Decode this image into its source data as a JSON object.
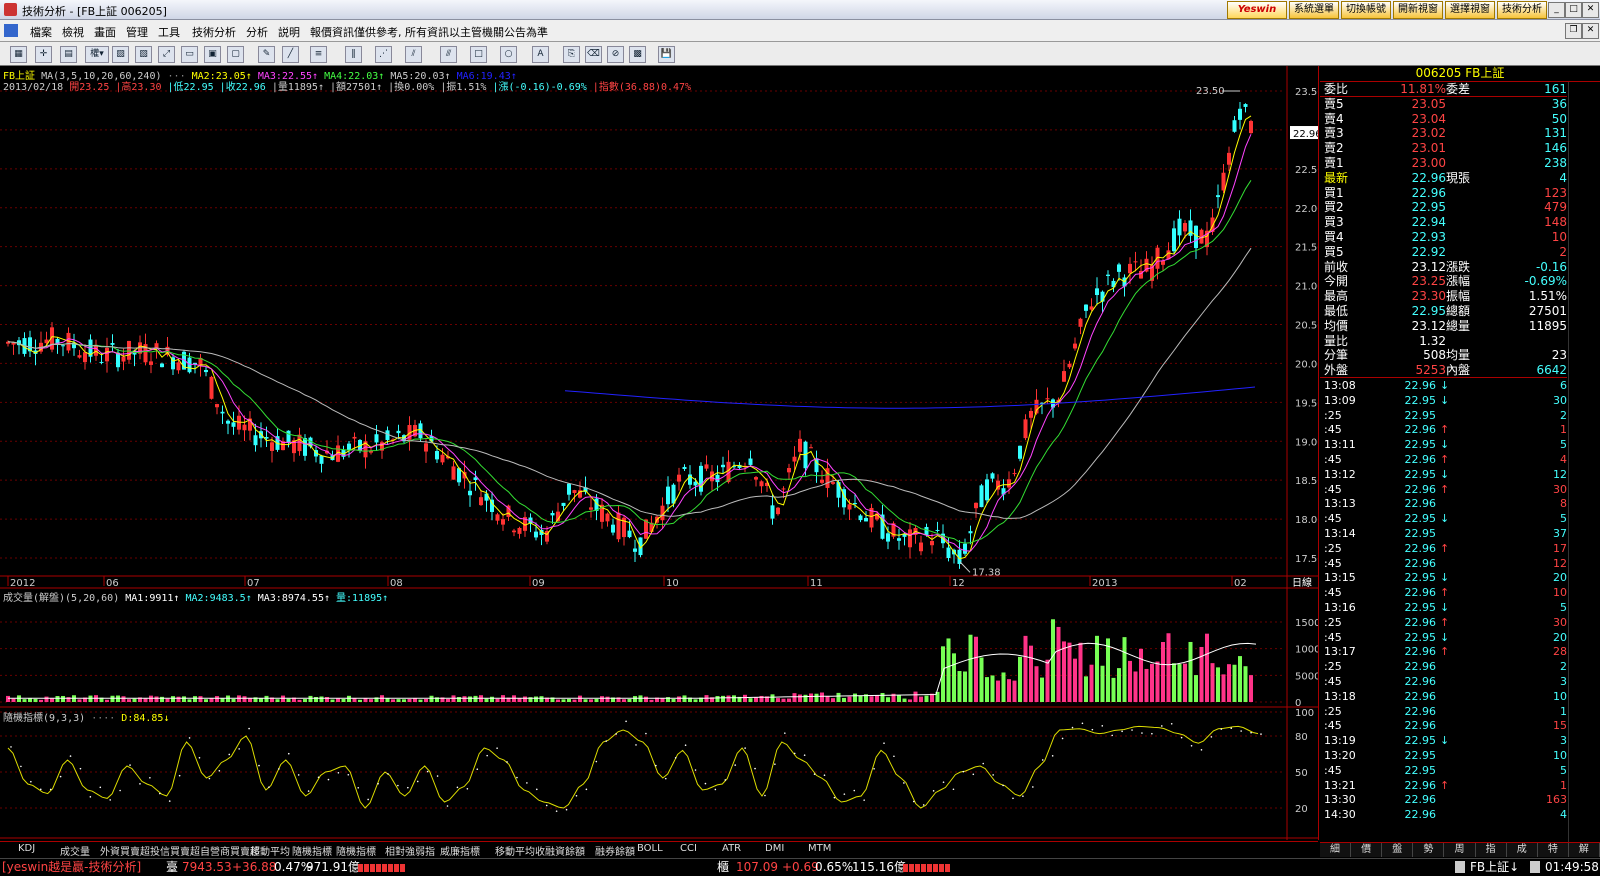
{
  "window": {
    "title": "技術分析 - [FB上証 006205]"
  },
  "topbar": {
    "logo": "Yeswin",
    "buttons": [
      "系統選單",
      "切換帳號",
      "開新視窗",
      "選擇視窗",
      "技術分析"
    ]
  },
  "menu": [
    "檔案",
    "檢視",
    "畫面",
    "管理",
    "工具",
    "技術分析",
    "分析",
    "説明",
    "報價資訊僅供參考, 所有資訊以主管機關公告為準"
  ],
  "chart": {
    "symbol": "FB上証",
    "ma_header": "MA(3,5,10,20,60,240)",
    "ma_values": [
      {
        "label": "MA2:23.05↑",
        "color": "#ffff00"
      },
      {
        "label": "MA3:22.55↑",
        "color": "#ff44ff"
      },
      {
        "label": "MA4:22.03↑",
        "color": "#44ff44"
      },
      {
        "label": "MA5:20.03↑",
        "color": "#cccccc"
      },
      {
        "label": "MA6:19.43↑",
        "color": "#2222ff"
      }
    ],
    "bar_info": [
      {
        "t": "2013/02/18 ",
        "c": "#cccccc"
      },
      {
        "t": "開23.25",
        "c": "#ff4444"
      },
      {
        "t": "|高23.30",
        "c": "#ff4444"
      },
      {
        "t": "|低22.95",
        "c": "#44ffff"
      },
      {
        "t": "|收22.96",
        "c": "#44ffff"
      },
      {
        "t": "|量11895↑",
        "c": "#cccccc"
      },
      {
        "t": "|額27501↑",
        "c": "#cccccc"
      },
      {
        "t": "|換0.00%",
        "c": "#cccccc"
      },
      {
        "t": "|振1.51%",
        "c": "#cccccc"
      },
      {
        "t": "|漲(-0.16)-0.69%",
        "c": "#44ffff"
      },
      {
        "t": "|指數(36.88)0.47%",
        "c": "#ff4444"
      }
    ],
    "price_axis": [
      "23.50",
      "23.00",
      "22.50",
      "22.00",
      "21.50",
      "21.00",
      "20.50",
      "20.00",
      "19.50",
      "19.00",
      "18.50",
      "18.00",
      "17.50"
    ],
    "current_price_tag": "22.96",
    "high_label": "23.50",
    "low_label": "17.38",
    "date_axis": [
      "2012",
      "06",
      "07",
      "08",
      "09",
      "10",
      "11",
      "12",
      "2013",
      "02"
    ],
    "date_axis_right": "日線",
    "volume_header": "成交量(解盤)(5,20,60)",
    "volume_values": [
      {
        "label": "MA1:9911↑",
        "color": "#ffffff"
      },
      {
        "label": "MA2:9483.5↑",
        "color": "#44ffff"
      },
      {
        "label": "MA3:8974.55↑",
        "color": "#ffffff"
      },
      {
        "label": "量:11895↑",
        "color": "#44ffff"
      }
    ],
    "volume_axis": [
      "15000",
      "10000",
      "5000",
      "0"
    ],
    "kd_header": "隨機指標(9,3,3)",
    "kd_value": "D:84.85↓",
    "kd_axis": [
      "100",
      "80",
      "50",
      "20"
    ],
    "chart_data": {
      "type": "candlestick",
      "kd_d": [
        70,
        40,
        32,
        60,
        35,
        28,
        55,
        40,
        30,
        75,
        45,
        60,
        80,
        35,
        60,
        30,
        50,
        55,
        20,
        50,
        30,
        55,
        25,
        38,
        70,
        60,
        35,
        25,
        20,
        40,
        75,
        85,
        75,
        45,
        68,
        35,
        40,
        70,
        30,
        75,
        60,
        45,
        25,
        30,
        68,
        45,
        20,
        35,
        50,
        55,
        40,
        30,
        55,
        85,
        86,
        82,
        85,
        88,
        87,
        82,
        74,
        86,
        88,
        82
      ]
    }
  },
  "tabs": [
    "KDJ",
    "成交量",
    "外資買賣超",
    "投信買賣超",
    "自營商買賣超",
    "移動平均",
    "隨機指標",
    "隨機指標",
    "相對強弱指",
    "威廉指標",
    "移動平均收",
    "融資餘額",
    "融券餘額",
    "BOLL",
    "CCI",
    "ATR",
    "DMI",
    "MTM"
  ],
  "quote": {
    "header": "006205 FB上証",
    "rows": [
      {
        "l": "委比",
        "v": "11.81%",
        "vc": "#ff4444",
        "l2": "委差",
        "v2": "161",
        "v2c": "#44ffff"
      },
      {
        "l": "賣5",
        "v": "23.05",
        "vc": "#ff4444",
        "l2": "",
        "v2": "36",
        "v2c": "#44ffff"
      },
      {
        "l": "賣4",
        "v": "23.04",
        "vc": "#ff4444",
        "l2": "",
        "v2": "50",
        "v2c": "#44ffff"
      },
      {
        "l": "賣3",
        "v": "23.02",
        "vc": "#ff4444",
        "l2": "",
        "v2": "131",
        "v2c": "#44ffff"
      },
      {
        "l": "賣2",
        "v": "23.01",
        "vc": "#ff4444",
        "l2": "",
        "v2": "146",
        "v2c": "#44ffff"
      },
      {
        "l": "賣1",
        "v": "23.00",
        "vc": "#ff4444",
        "l2": "",
        "v2": "238",
        "v2c": "#44ffff"
      },
      {
        "l": "最新",
        "v": "22.96",
        "vc": "#44ffff",
        "l2": "現張",
        "v2": "4",
        "v2c": "#44ffff"
      },
      {
        "l": "買1",
        "v": "22.96",
        "vc": "#44ffff",
        "l2": "",
        "v2": "123",
        "v2c": "#ff4444"
      },
      {
        "l": "買2",
        "v": "22.95",
        "vc": "#44ffff",
        "l2": "",
        "v2": "479",
        "v2c": "#ff4444"
      },
      {
        "l": "買3",
        "v": "22.94",
        "vc": "#44ffff",
        "l2": "",
        "v2": "148",
        "v2c": "#ff4444"
      },
      {
        "l": "買4",
        "v": "22.93",
        "vc": "#44ffff",
        "l2": "",
        "v2": "10",
        "v2c": "#ff4444"
      },
      {
        "l": "買5",
        "v": "22.92",
        "vc": "#44ffff",
        "l2": "",
        "v2": "2",
        "v2c": "#ff4444"
      },
      {
        "l": "前收",
        "v": "23.12",
        "vc": "#ffffff",
        "l2": "漲跌",
        "v2": "-0.16",
        "v2c": "#44ffff"
      },
      {
        "l": "今開",
        "v": "23.25",
        "vc": "#ff4444",
        "l2": "漲幅",
        "v2": "-0.69%",
        "v2c": "#44ffff"
      },
      {
        "l": "最高",
        "v": "23.30",
        "vc": "#ff4444",
        "l2": "振幅",
        "v2": "1.51%",
        "v2c": "#ffffff"
      },
      {
        "l": "最低",
        "v": "22.95",
        "vc": "#44ffff",
        "l2": "總額",
        "v2": "27501",
        "v2c": "#ffffff"
      },
      {
        "l": "均價",
        "v": "23.12",
        "vc": "#ffffff",
        "l2": "總量",
        "v2": "11895",
        "v2c": "#ffffff"
      },
      {
        "l": "量比",
        "v": "1.32",
        "vc": "#ffffff",
        "l2": "",
        "v2": "",
        "v2c": "#ffffff"
      },
      {
        "l": "分筆",
        "v": "508",
        "vc": "#ffffff",
        "l2": "均量",
        "v2": "23",
        "v2c": "#ffffff"
      },
      {
        "l": "外盤",
        "v": "5253",
        "vc": "#ff4444",
        "l2": "內盤",
        "v2": "6642",
        "v2c": "#44ffff"
      }
    ],
    "ticks": [
      {
        "t": "13:08",
        "p": "22.96",
        "pc": "#44ffff",
        "a": "↓",
        "ac": "#44ffff",
        "v": "6",
        "vc": "#44ffff"
      },
      {
        "t": "13:09",
        "p": "22.95",
        "pc": "#44ffff",
        "a": "↓",
        "ac": "#44ffff",
        "v": "30",
        "vc": "#44ffff"
      },
      {
        "t": ":25",
        "p": "22.95",
        "pc": "#44ffff",
        "a": "",
        "ac": "#44ffff",
        "v": "2",
        "vc": "#44ffff"
      },
      {
        "t": ":45",
        "p": "22.96",
        "pc": "#44ffff",
        "a": "↑",
        "ac": "#ff4444",
        "v": "1",
        "vc": "#ff4444"
      },
      {
        "t": "13:11",
        "p": "22.95",
        "pc": "#44ffff",
        "a": "↓",
        "ac": "#44ffff",
        "v": "5",
        "vc": "#44ffff"
      },
      {
        "t": ":45",
        "p": "22.96",
        "pc": "#44ffff",
        "a": "↑",
        "ac": "#ff4444",
        "v": "4",
        "vc": "#ff4444"
      },
      {
        "t": "13:12",
        "p": "22.95",
        "pc": "#44ffff",
        "a": "↓",
        "ac": "#44ffff",
        "v": "12",
        "vc": "#44ffff"
      },
      {
        "t": ":45",
        "p": "22.96",
        "pc": "#44ffff",
        "a": "↑",
        "ac": "#ff4444",
        "v": "30",
        "vc": "#ff4444"
      },
      {
        "t": "13:13",
        "p": "22.96",
        "pc": "#44ffff",
        "a": "",
        "ac": "#44ffff",
        "v": "8",
        "vc": "#ff4444"
      },
      {
        "t": ":45",
        "p": "22.95",
        "pc": "#44ffff",
        "a": "↓",
        "ac": "#44ffff",
        "v": "5",
        "vc": "#44ffff"
      },
      {
        "t": "13:14",
        "p": "22.95",
        "pc": "#44ffff",
        "a": "",
        "ac": "#44ffff",
        "v": "37",
        "vc": "#44ffff"
      },
      {
        "t": ":25",
        "p": "22.96",
        "pc": "#44ffff",
        "a": "↑",
        "ac": "#ff4444",
        "v": "17",
        "vc": "#ff4444"
      },
      {
        "t": ":45",
        "p": "22.96",
        "pc": "#44ffff",
        "a": "",
        "ac": "#44ffff",
        "v": "12",
        "vc": "#ff4444"
      },
      {
        "t": "13:15",
        "p": "22.95",
        "pc": "#44ffff",
        "a": "↓",
        "ac": "#44ffff",
        "v": "20",
        "vc": "#44ffff"
      },
      {
        "t": ":45",
        "p": "22.96",
        "pc": "#44ffff",
        "a": "↑",
        "ac": "#ff4444",
        "v": "10",
        "vc": "#ff4444"
      },
      {
        "t": "13:16",
        "p": "22.95",
        "pc": "#44ffff",
        "a": "↓",
        "ac": "#44ffff",
        "v": "5",
        "vc": "#44ffff"
      },
      {
        "t": ":25",
        "p": "22.96",
        "pc": "#44ffff",
        "a": "↑",
        "ac": "#ff4444",
        "v": "30",
        "vc": "#ff4444"
      },
      {
        "t": ":45",
        "p": "22.95",
        "pc": "#44ffff",
        "a": "↓",
        "ac": "#44ffff",
        "v": "20",
        "vc": "#44ffff"
      },
      {
        "t": "13:17",
        "p": "22.96",
        "pc": "#44ffff",
        "a": "↑",
        "ac": "#ff4444",
        "v": "28",
        "vc": "#ff4444"
      },
      {
        "t": ":25",
        "p": "22.96",
        "pc": "#44ffff",
        "a": "",
        "ac": "#44ffff",
        "v": "2",
        "vc": "#44ffff"
      },
      {
        "t": ":45",
        "p": "22.96",
        "pc": "#44ffff",
        "a": "",
        "ac": "#44ffff",
        "v": "3",
        "vc": "#44ffff"
      },
      {
        "t": "13:18",
        "p": "22.96",
        "pc": "#44ffff",
        "a": "",
        "ac": "#44ffff",
        "v": "10",
        "vc": "#44ffff"
      },
      {
        "t": ":25",
        "p": "22.96",
        "pc": "#44ffff",
        "a": "",
        "ac": "#44ffff",
        "v": "1",
        "vc": "#44ffff"
      },
      {
        "t": ":45",
        "p": "22.96",
        "pc": "#44ffff",
        "a": "",
        "ac": "#44ffff",
        "v": "15",
        "vc": "#ff4444"
      },
      {
        "t": "13:19",
        "p": "22.95",
        "pc": "#44ffff",
        "a": "↓",
        "ac": "#44ffff",
        "v": "3",
        "vc": "#44ffff"
      },
      {
        "t": "13:20",
        "p": "22.95",
        "pc": "#44ffff",
        "a": "",
        "ac": "#44ffff",
        "v": "10",
        "vc": "#44ffff"
      },
      {
        "t": ":45",
        "p": "22.95",
        "pc": "#44ffff",
        "a": "",
        "ac": "#44ffff",
        "v": "5",
        "vc": "#44ffff"
      },
      {
        "t": "13:21",
        "p": "22.96",
        "pc": "#44ffff",
        "a": "↑",
        "ac": "#ff4444",
        "v": "1",
        "vc": "#ff4444"
      },
      {
        "t": "13:30",
        "p": "22.96",
        "pc": "#44ffff",
        "a": "",
        "ac": "#44ffff",
        "v": "163",
        "vc": "#ff4444"
      },
      {
        "t": "14:30",
        "p": "22.96",
        "pc": "#44ffff",
        "a": "",
        "ac": "#44ffff",
        "v": "4",
        "vc": "#44ffff"
      }
    ],
    "side_buttons": [
      "細",
      "價",
      "盤",
      "勢",
      "周",
      "指",
      "成",
      "特",
      "解"
    ]
  },
  "status": {
    "brand": "[yeswin越是贏-技術分析]",
    "idx1_name": "臺",
    "idx1_value": "7943.53",
    "idx1_change": "+36.88",
    "idx1_pct": "0.47%",
    "idx1_amount": "971.91億",
    "idx2_name": "櫃",
    "idx2_value": "107.09",
    "idx2_change": "+0.69",
    "idx2_pct": "0.65%",
    "idx2_amount": "115.16億",
    "symbol_status": "FB上証↓",
    "clock": "01:49:58"
  }
}
